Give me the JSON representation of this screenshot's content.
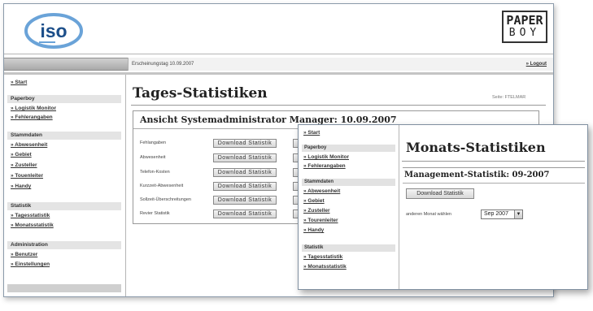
{
  "header": {
    "iso_logo_text": "iso",
    "paperboy_logo_line1": "PAPER",
    "paperboy_logo_line2": "BOY",
    "date_label": "Erscheinungstag 10.09.2007",
    "logout": "» Logout"
  },
  "sidebar": {
    "start": "» Start",
    "sections": [
      {
        "title": "Paperboy",
        "items": [
          "» Logistik Monitor",
          "» Fehlerangaben"
        ]
      },
      {
        "title": "Stammdaten",
        "items": [
          "» Abwesenheit",
          "» Gebiet",
          "» Zusteller",
          "» Touenleiter",
          "» Handy"
        ]
      },
      {
        "title": "Statistik",
        "items": [
          "» Tagesstatistik",
          "» Monatsstatistik"
        ]
      },
      {
        "title": "Administration",
        "items": [
          "» Benutzer",
          "» Einstellungen"
        ]
      }
    ]
  },
  "main": {
    "title": "Tages-Statistiken",
    "seite": "Seite: FTELMAR",
    "panel_title": "Ansicht Systemadministrator Manager: 10.09.2007",
    "rows": [
      {
        "label": "Fehlangaben",
        "button": "Download Statistik"
      },
      {
        "label": "Abwesenheit",
        "button": "Download Statistik"
      },
      {
        "label": "Telefon-Kosten",
        "button": "Download Statistik"
      },
      {
        "label": "Kurzzeit-Abwesenheit",
        "button": "Download Statistik"
      },
      {
        "label": "Sollzeit-Überschreitungen",
        "button": "Download Statistik"
      },
      {
        "label": "Revier Statistik",
        "button": "Download Statistik"
      }
    ]
  },
  "overlay": {
    "sidebar": {
      "start": "» Start",
      "sections": [
        {
          "title": "Paperboy",
          "items": [
            "» Logistik Monitor",
            "» Fehlerangaben"
          ]
        },
        {
          "title": "Stammdaten",
          "items": [
            "» Abwesenheit",
            "» Gebiet",
            "» Zusteller",
            "» Tourenleiter",
            "» Handy"
          ]
        },
        {
          "title": "Statistik",
          "items": [
            "» Tagesstatistik",
            "» Monatsstatistik"
          ]
        }
      ]
    },
    "title": "Monats-Statistiken",
    "panel_title": "Management-Statistik: 09-2007",
    "download_button": "Download Statistik",
    "month_label": "anderen Monat wählen",
    "month_value": "Sep 2007"
  },
  "colors": {
    "bar": "#a9a9a9",
    "section_bg": "#e4e4e4",
    "border": "#8a9aaa"
  }
}
